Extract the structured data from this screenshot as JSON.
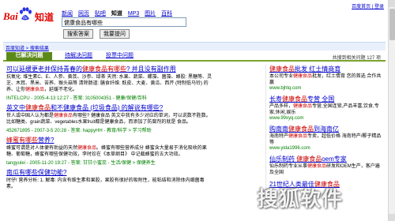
{
  "logo": {
    "bai": "Bai",
    "zhidao": "知道"
  },
  "topnav": [
    "新闻",
    "网页",
    "贴吧",
    "知道",
    "MP3",
    "图片",
    "百科"
  ],
  "topnav_current_index": 3,
  "topright": "百度首页 | 登录",
  "search": {
    "value": "健康食品有哪些",
    "btn_search": "搜索答案",
    "btn_ask": "我要提问"
  },
  "crumb": "百度知道 > 搜索结果",
  "tabs": {
    "active": "已解决问题",
    "t2": "待解决问题",
    "t3": "投票中问题",
    "count": "共搜到相关问题 127 项"
  },
  "results": [
    {
      "title_pre": "可以延缓更老并保持青春的",
      "title_hl": "健康食品有哪些",
      "title_post": "? 并且没有副作用",
      "snippet": "抗氧化: 维生素C、E、人参、黄芪、沙参、绿茶 天然: 水果、蔬菜、螺藻、菌藻、蜂胶: 黑糖等、灵芝、木耳、黑米、苦荞、猴头菇等 清除肠道: 膳食纤维: 麸皮、大麦、黄瓜、西芹 (特制低马铃) 的养、让你",
      "snippet_hl": "健康食品",
      "snippet_tail": "，延缓不老化。",
      "meta": "INTELCPU - 2005-4-13 12:27 - 答案: 3105004351 - 健康/保健/百科"
    },
    {
      "title_pre": "英文中",
      "title_hl": "健康食品",
      "title_post": "和不健康食品 (垃圾食品) 的解说有哪些?",
      "snippet": "世人或中国人认为都是",
      "snippet_hl": "健康食品",
      "snippet_tail": "有哪些? 健康食品 英文中我有多少对应的单词，可以说数不胜数。比如糖类、grain蔬菜、vegetables水果fruit都是健康食品，而添加了防腐剂的就是 食品。",
      "meta": "452671895 - 2007-3-5 20:28 - 答案: happyHH - 教育/科学 > 学习帮助"
    },
    {
      "title_pre": "",
      "title_hl": "蜂蜜有哪些",
      "title_post": "营养?",
      "snippet": "蜂蜜可谓是对人体便有助益的天然",
      "snippet_hl": "健康食品",
      "snippet_tail": "。蜂蜜有哪些营养成分 蜂蜜含大量易于消化吸收的果糖、葡萄糖，蜂蜜有哪些保健功效，李时珍在《本草纲目》 中记载蜂蜜的五大功效。",
      "meta": "tangyulei - 2005-11-20 19:27 - 答案: 甘甘小蜜蕊 - 生活/保健 > 保健养生"
    },
    {
      "title_pre": "南瓜有哪些保健功能?",
      "title_hl": "",
      "title_post": "",
      "snippet": "时仔! 营养分析: 1. 解毒: 内含有维生素和果胶，果胶有很好的吸附性，能粘结和消除体内细菌毒素。",
      "snippet_hl": "",
      "snippet_tail": "",
      "meta": ""
    }
  ],
  "ads": [
    {
      "title_pre": "",
      "title_hl": "健康食品",
      "title_post": "批发 红土情商育",
      "desc_pre": "本公司专业",
      "desc_hl": "健康食品",
      "desc_post": "批发，红土情育 您的首选 合作共赢",
      "url": "www.bjhtq.com"
    },
    {
      "title_pre": "长寿",
      "title_hl": "健康食品",
      "title_post": "专营 全国",
      "desc_pre": "产品多样，",
      "desc_hl": "健康食品",
      "desc_post": "专营,全国连锁,产品丰富,饮食,专家,休闲,娱乐",
      "url": "www.99xyq.com"
    },
    {
      "title_pre": "购南南",
      "title_hl": "健康食品",
      "title_post": "到海南亿",
      "desc_pre": "海南特产",
      "desc_hl": "健康食品",
      "desc_post": "专卖，超低价格 海南特产/椰子精品等",
      "url": "www.yida1996.com"
    },
    {
      "title_pre": "仙乐制药 ",
      "title_hl": "健康食品",
      "title_post": "oem专家",
      "desc_pre": "仙乐制药专业从事",
      "desc_hl": "健康食品",
      "desc_post": "研发和OEM生产，客户遍及全国",
      "url": ""
    },
    {
      "title_pre": "21世纪人类最佳",
      "title_hl": "健康食品",
      "title_post": "",
      "desc_pre": "",
      "desc_hl": "",
      "desc_post": "",
      "url": ""
    }
  ],
  "watermark": "搜狐软件"
}
